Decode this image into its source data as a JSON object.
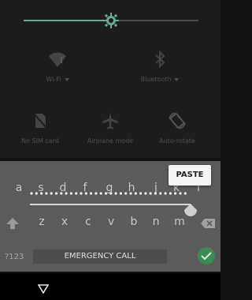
{
  "quick_settings": {
    "brightness_level": 0.5,
    "tiles": [
      {
        "label": "Wi-Fi",
        "icon": "wifi-icon",
        "has_dropdown": true
      },
      {
        "label": "Bluetooth",
        "icon": "bluetooth-icon",
        "has_dropdown": true
      },
      {
        "label": "No SIM card",
        "icon": "no-sim-icon",
        "has_dropdown": false
      },
      {
        "label": "Airplane mode",
        "icon": "airplane-icon",
        "has_dropdown": false
      },
      {
        "label": "Auto-rotate",
        "icon": "auto-rotate-icon",
        "has_dropdown": false
      }
    ]
  },
  "keyboard": {
    "row2": [
      "a",
      "s",
      "d",
      "f",
      "g",
      "h",
      "j",
      "k",
      "l"
    ],
    "row3": [
      "z",
      "x",
      "c",
      "v",
      "b",
      "n",
      "m"
    ],
    "symbols_label": "?123",
    "shift_icon": "shift-arrow-icon",
    "delete_icon": "backspace-icon",
    "enter_icon": "checkmark-icon"
  },
  "paste_label": "PASTE",
  "emergency_call_label": "EMERGENCY CALL",
  "nav": {
    "back_icon": "back-triangle-icon"
  },
  "colors": {
    "accent": "#6aa99a",
    "enter_green": "#3d8a55"
  }
}
